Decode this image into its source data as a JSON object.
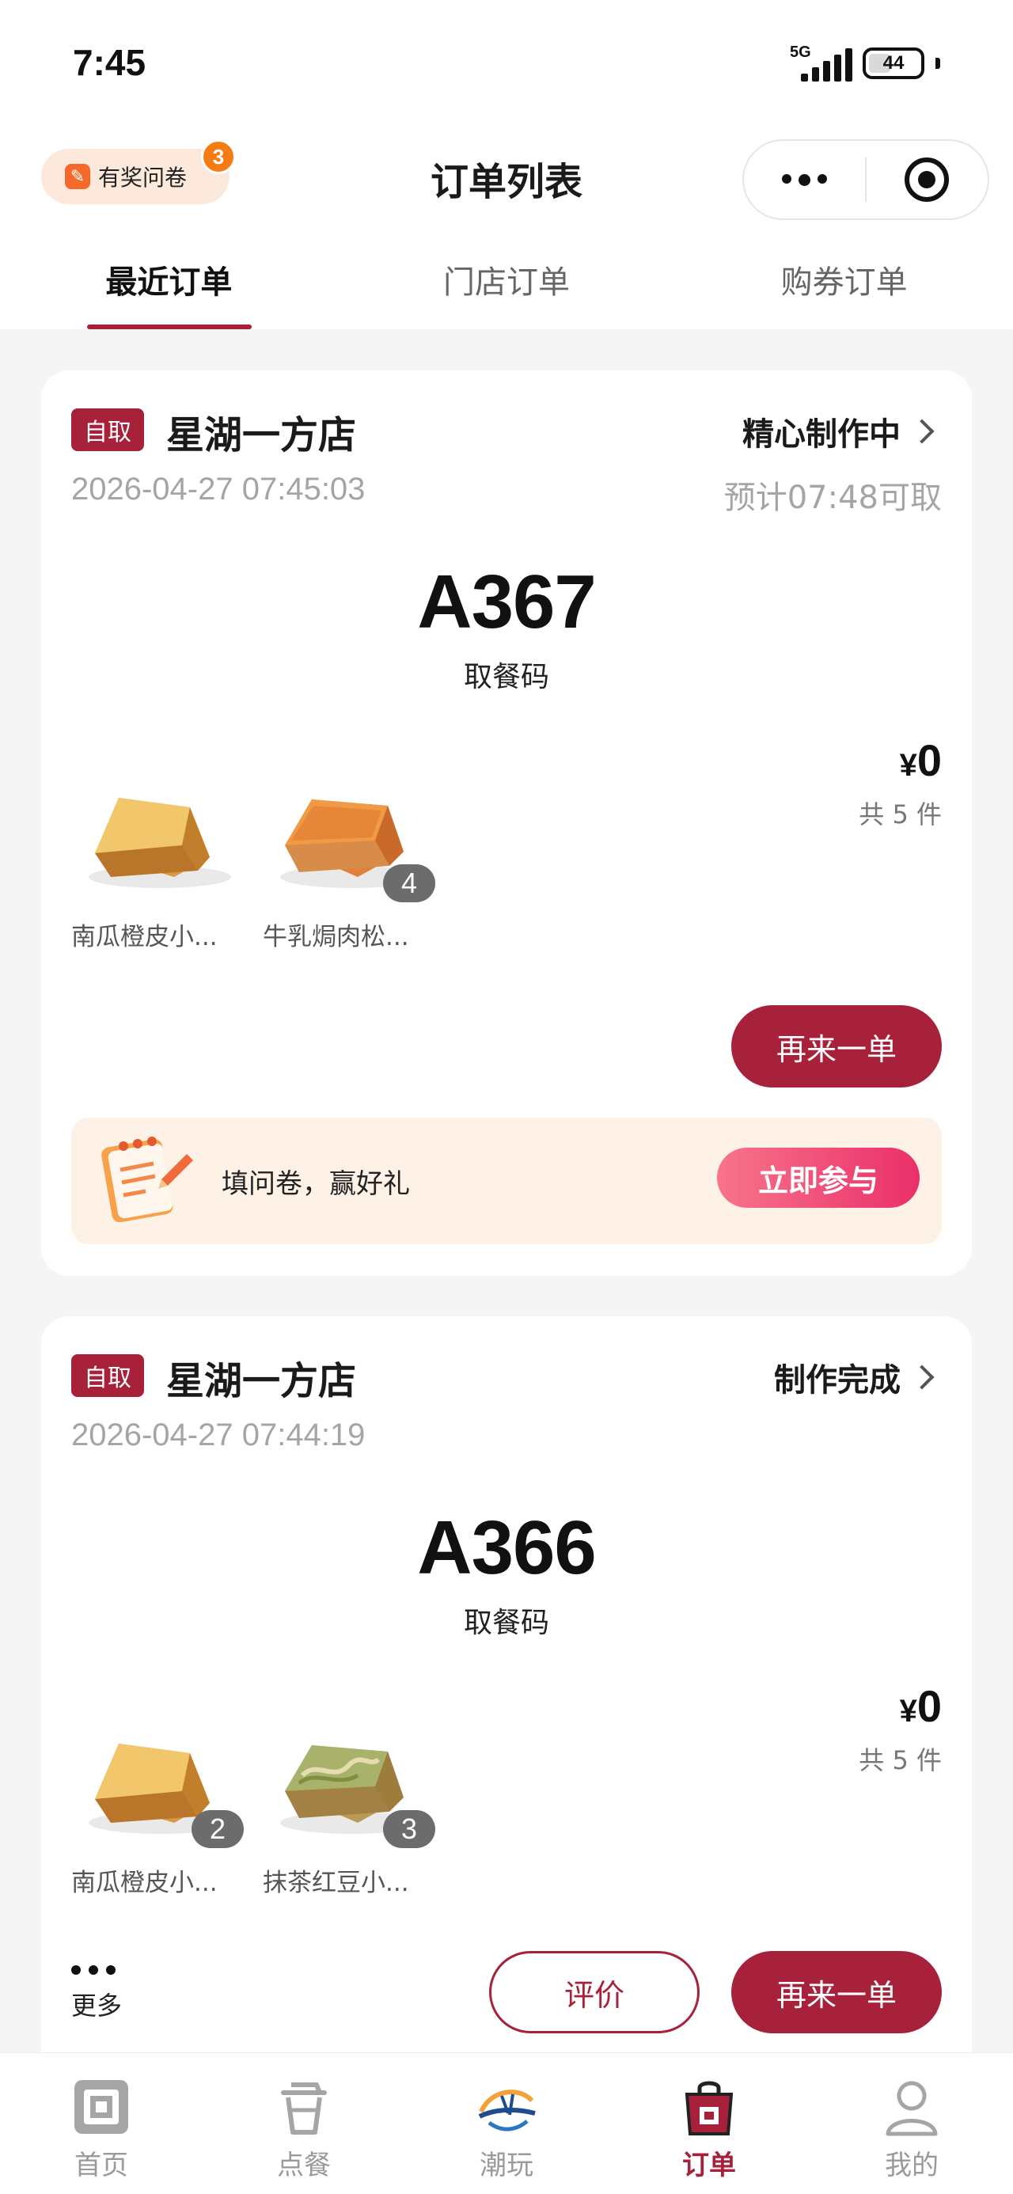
{
  "status_bar": {
    "time": "7:45",
    "network": "5G",
    "battery": "44",
    "battery_fraction": 0.44
  },
  "header": {
    "survey_badge": {
      "icon": "survey-icon",
      "label": "有奖问卷",
      "count": "3"
    },
    "title": "订单列表",
    "capsule": {
      "more": "more-dots-icon",
      "close": "target-close-icon"
    }
  },
  "tabs": [
    {
      "label": "最近订单",
      "active": true
    },
    {
      "label": "门店订单",
      "active": false
    },
    {
      "label": "购券订单",
      "active": false
    }
  ],
  "orders": [
    {
      "tag": "自取",
      "store": "星湖一方店",
      "status": "精心制作中",
      "time": "2026-04-27 07:45:03",
      "eta": "预计07:48可取",
      "code": "A367",
      "code_label": "取餐码",
      "currency": "¥",
      "price": "0",
      "count_text": "共 5 件",
      "items": [
        {
          "name": "南瓜橙皮小...",
          "qty": "",
          "image": "pumpkin-toast"
        },
        {
          "name": "牛乳焗肉松...",
          "qty": "4",
          "image": "pork-floss-toast"
        }
      ],
      "reorder_label": "再来一单",
      "promo": {
        "icon": "survey-notepad-icon",
        "text": "填问卷，赢好礼",
        "button": "立即参与"
      }
    },
    {
      "tag": "自取",
      "store": "星湖一方店",
      "status": "制作完成",
      "time": "2026-04-27 07:44:19",
      "eta": "",
      "code": "A366",
      "code_label": "取餐码",
      "currency": "¥",
      "price": "0",
      "count_text": "共 5 件",
      "items": [
        {
          "name": "南瓜橙皮小...",
          "qty": "2",
          "image": "pumpkin-toast"
        },
        {
          "name": "抹茶红豆小...",
          "qty": "3",
          "image": "matcha-toast"
        }
      ],
      "more_label": "更多",
      "review_label": "评价",
      "reorder_label": "再来一单"
    }
  ],
  "tabbar": [
    {
      "label": "首页",
      "icon": "home-icon",
      "active": false
    },
    {
      "label": "点餐",
      "icon": "cup-icon",
      "active": false
    },
    {
      "label": "潮玩",
      "icon": "brand-logo-icon",
      "active": false
    },
    {
      "label": "订单",
      "icon": "order-bag-icon",
      "active": true
    },
    {
      "label": "我的",
      "icon": "profile-icon",
      "active": false
    }
  ],
  "colors": {
    "accent": "#a8213a",
    "background": "#f5f5f5",
    "muted_text": "#a5a5a5",
    "promo_bg": "#fef1e6"
  }
}
